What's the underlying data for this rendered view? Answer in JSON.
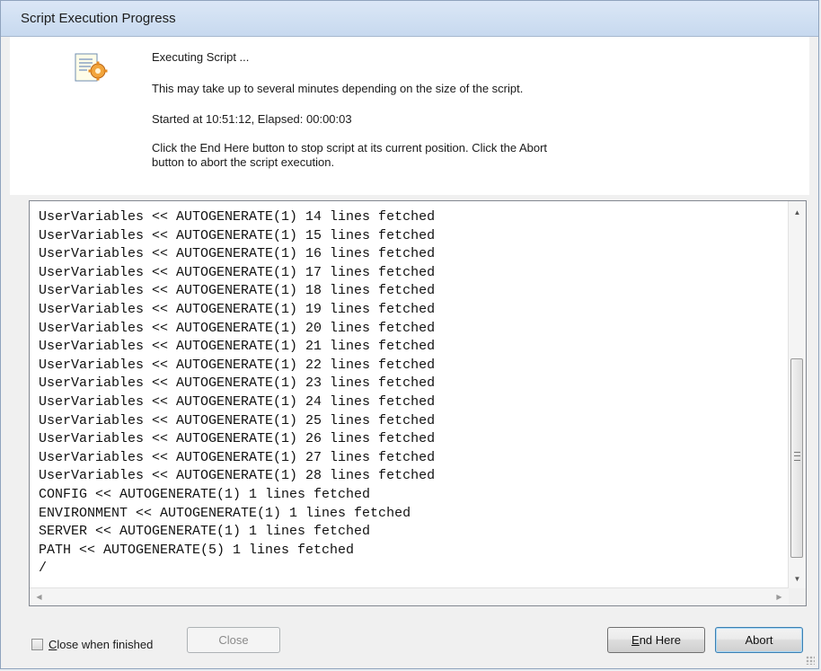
{
  "window": {
    "title": "Script Execution Progress"
  },
  "header": {
    "icon": "script-settings-icon",
    "status": "Executing Script ...",
    "note": "This may take up to several minutes depending on the size of the script.",
    "timing": "Started at 10:51:12, Elapsed: 00:00:03",
    "instructions_line1": "Click the End Here button to stop script at its current position. Click the Abort",
    "instructions_line2": "button to abort the script execution."
  },
  "log": {
    "lines": [
      "UserVariables << AUTOGENERATE(1) 14 lines fetched",
      "UserVariables << AUTOGENERATE(1) 15 lines fetched",
      "UserVariables << AUTOGENERATE(1) 16 lines fetched",
      "UserVariables << AUTOGENERATE(1) 17 lines fetched",
      "UserVariables << AUTOGENERATE(1) 18 lines fetched",
      "UserVariables << AUTOGENERATE(1) 19 lines fetched",
      "UserVariables << AUTOGENERATE(1) 20 lines fetched",
      "UserVariables << AUTOGENERATE(1) 21 lines fetched",
      "UserVariables << AUTOGENERATE(1) 22 lines fetched",
      "UserVariables << AUTOGENERATE(1) 23 lines fetched",
      "UserVariables << AUTOGENERATE(1) 24 lines fetched",
      "UserVariables << AUTOGENERATE(1) 25 lines fetched",
      "UserVariables << AUTOGENERATE(1) 26 lines fetched",
      "UserVariables << AUTOGENERATE(1) 27 lines fetched",
      "UserVariables << AUTOGENERATE(1) 28 lines fetched",
      "CONFIG << AUTOGENERATE(1) 1 lines fetched",
      "ENVIRONMENT << AUTOGENERATE(1) 1 lines fetched",
      "SERVER << AUTOGENERATE(1) 1 lines fetched",
      "PATH << AUTOGENERATE(5) 1 lines fetched",
      "/"
    ]
  },
  "footer": {
    "close_when_finished_prefix": "C",
    "close_when_finished_rest": "lose when finished",
    "close_when_finished_checked": false,
    "close_label": "Close",
    "end_here_prefix": "E",
    "end_here_rest": "nd Here",
    "abort_label": "Abort"
  },
  "colors": {
    "titlebar": "#c7d9ef",
    "default_button_border": "#3c7fb1"
  }
}
